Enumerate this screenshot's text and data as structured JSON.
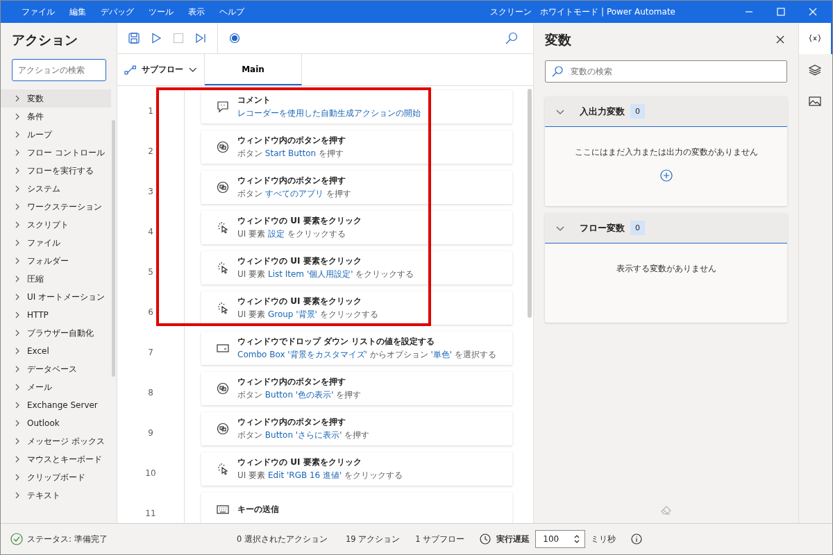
{
  "window": {
    "title": "スクリーン　ホワイトモード | Power Automate"
  },
  "menu": [
    "ファイル",
    "編集",
    "デバッグ",
    "ツール",
    "表示",
    "ヘルプ"
  ],
  "actions_panel": {
    "title": "アクション",
    "search": {
      "placeholder": "アクションの検索"
    },
    "items": [
      {
        "label": "変数",
        "selected": true
      },
      {
        "label": "条件",
        "selected": false
      },
      {
        "label": "ループ",
        "selected": false
      },
      {
        "label": "フロー コントロール",
        "selected": false
      },
      {
        "label": "フローを実行する",
        "selected": false
      },
      {
        "label": "システム",
        "selected": false
      },
      {
        "label": "ワークステーション",
        "selected": false
      },
      {
        "label": "スクリプト",
        "selected": false
      },
      {
        "label": "ファイル",
        "selected": false
      },
      {
        "label": "フォルダー",
        "selected": false
      },
      {
        "label": "圧縮",
        "selected": false
      },
      {
        "label": "UI オートメーション",
        "selected": false
      },
      {
        "label": "HTTP",
        "selected": false
      },
      {
        "label": "ブラウザー自動化",
        "selected": false
      },
      {
        "label": "Excel",
        "selected": false
      },
      {
        "label": "データベース",
        "selected": false
      },
      {
        "label": "メール",
        "selected": false
      },
      {
        "label": "Exchange Server",
        "selected": false
      },
      {
        "label": "Outlook",
        "selected": false
      },
      {
        "label": "メッセージ ボックス",
        "selected": false
      },
      {
        "label": "マウスとキーボード",
        "selected": false
      },
      {
        "label": "クリップボード",
        "selected": false
      },
      {
        "label": "テキスト",
        "selected": false
      }
    ]
  },
  "subflow_button": {
    "label": "サブフロー"
  },
  "tabs": [
    {
      "label": "Main",
      "selected": true
    }
  ],
  "steps": [
    {
      "number": "1",
      "kind": "comment",
      "title": "コメント",
      "highlighted": true,
      "detail": [
        {
          "kind": "value",
          "text": "レコーダーを使用した自動生成アクションの開始"
        }
      ]
    },
    {
      "number": "2",
      "kind": "button",
      "title": "ウィンドウ内のボタンを押す",
      "highlighted": true,
      "detail": [
        {
          "kind": "plain",
          "text": "ボタン "
        },
        {
          "kind": "value",
          "text": "Start Button"
        },
        {
          "kind": "plain",
          "text": " を押す"
        }
      ]
    },
    {
      "number": "3",
      "kind": "button",
      "title": "ウィンドウ内のボタンを押す",
      "highlighted": true,
      "detail": [
        {
          "kind": "plain",
          "text": "ボタン "
        },
        {
          "kind": "value",
          "text": "すべてのアプリ"
        },
        {
          "kind": "plain",
          "text": " を押す"
        }
      ]
    },
    {
      "number": "4",
      "kind": "click",
      "title": "ウィンドウの UI 要素をクリック",
      "highlighted": true,
      "detail": [
        {
          "kind": "plain",
          "text": "UI 要素 "
        },
        {
          "kind": "value",
          "text": "設定"
        },
        {
          "kind": "plain",
          "text": " をクリックする"
        }
      ]
    },
    {
      "number": "5",
      "kind": "click",
      "title": "ウィンドウの UI 要素をクリック",
      "highlighted": true,
      "detail": [
        {
          "kind": "plain",
          "text": "UI 要素 "
        },
        {
          "kind": "value",
          "text": "List Item '個人用設定'"
        },
        {
          "kind": "plain",
          "text": " をクリックする"
        }
      ]
    },
    {
      "number": "6",
      "kind": "click",
      "title": "ウィンドウの UI 要素をクリック",
      "highlighted": true,
      "detail": [
        {
          "kind": "plain",
          "text": "UI 要素 "
        },
        {
          "kind": "value",
          "text": "Group '背景'"
        },
        {
          "kind": "plain",
          "text": " をクリックする"
        }
      ]
    },
    {
      "number": "7",
      "kind": "dropdown",
      "title": "ウィンドウでドロップ ダウン リストの値を設定する",
      "highlighted": false,
      "detail": [
        {
          "kind": "value",
          "text": "Combo Box '背景をカスタマイズ'"
        },
        {
          "kind": "plain",
          "text": " からオプション "
        },
        {
          "kind": "value",
          "text": "'単色'"
        },
        {
          "kind": "plain",
          "text": " を選択する"
        }
      ]
    },
    {
      "number": "8",
      "kind": "button",
      "title": "ウィンドウ内のボタンを押す",
      "highlighted": false,
      "detail": [
        {
          "kind": "plain",
          "text": "ボタン "
        },
        {
          "kind": "value",
          "text": "Button '色の表示'"
        },
        {
          "kind": "plain",
          "text": " を押す"
        }
      ]
    },
    {
      "number": "9",
      "kind": "button",
      "title": "ウィンドウ内のボタンを押す",
      "highlighted": false,
      "detail": [
        {
          "kind": "plain",
          "text": "ボタン "
        },
        {
          "kind": "value",
          "text": "Button 'さらに表示'"
        },
        {
          "kind": "plain",
          "text": " を押す"
        }
      ]
    },
    {
      "number": "10",
      "kind": "click",
      "title": "ウィンドウの UI 要素をクリック",
      "highlighted": false,
      "detail": [
        {
          "kind": "plain",
          "text": "UI 要素 "
        },
        {
          "kind": "value",
          "text": "Edit 'RGB 16 進値'"
        },
        {
          "kind": "plain",
          "text": " をクリックする"
        }
      ]
    },
    {
      "number": "11",
      "kind": "keyboard",
      "title": "キーの送信",
      "highlighted": false
    }
  ],
  "variables_panel": {
    "title": "変数",
    "search": {
      "placeholder": "変数の検索"
    },
    "sections": [
      {
        "title": "入出力変数",
        "count": "0",
        "expanded": true,
        "empty_text": "ここにはまだ入力または出力の変数がありません",
        "can_add": true
      },
      {
        "title": "フロー変数",
        "count": "0",
        "expanded": true,
        "empty_text": "表示する変数がありません",
        "can_add": false
      }
    ]
  },
  "rail": [
    {
      "kind": "variables",
      "selected": true
    },
    {
      "kind": "layers",
      "selected": false
    },
    {
      "kind": "images",
      "selected": false
    }
  ],
  "status_bar": {
    "status": "ステータス: 準備完了",
    "selected_actions": "0 選択されたアクション",
    "actions": "19 アクション",
    "subflows": "1 サブフロー",
    "delay_label": "実行遅延",
    "delay_value": "100",
    "unit": "ミリ秒"
  }
}
